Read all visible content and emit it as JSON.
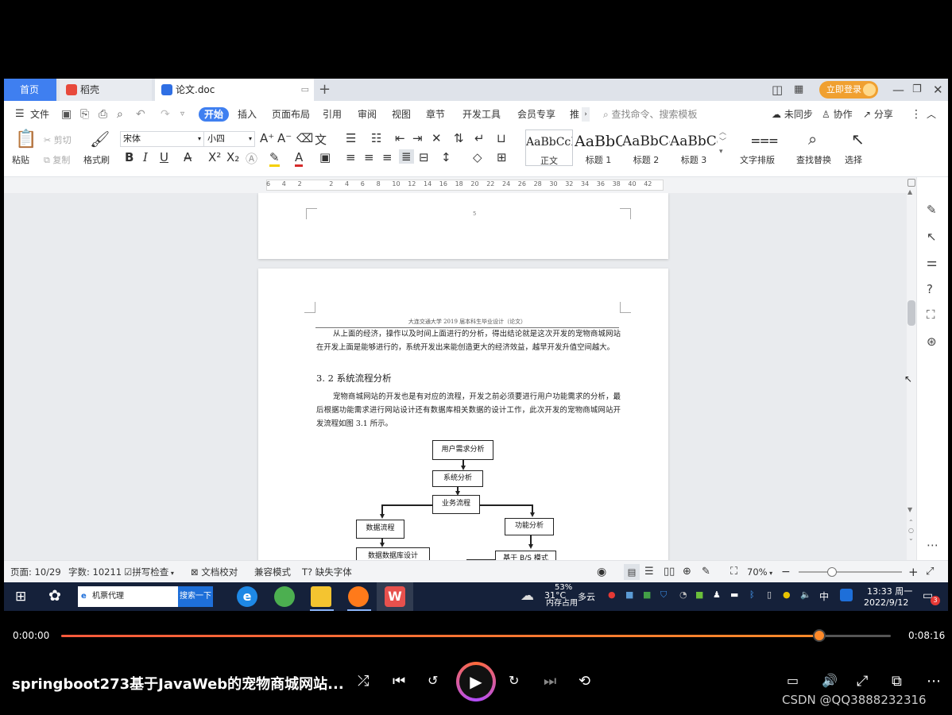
{
  "tabs": {
    "home": "首页",
    "daoke": "稻壳",
    "doc": "论文.doc",
    "login": "立即登录"
  },
  "menu": {
    "file": "文件",
    "items": [
      "开始",
      "插入",
      "页面布局",
      "引用",
      "审阅",
      "视图",
      "章节",
      "开发工具",
      "会员专享",
      "推"
    ],
    "search_placeholder": "查找命令、搜索模板",
    "unsynced": "未同步",
    "collab": "协作",
    "share": "分享"
  },
  "ribbon": {
    "paste": "粘贴",
    "cut": "剪切",
    "copy": "复制",
    "format_painter": "格式刷",
    "font_name": "宋体",
    "font_size": "小四",
    "styles": [
      {
        "sample": "AaBbCcI",
        "name": "正文"
      },
      {
        "sample": "AaBbC",
        "name": "标题 1"
      },
      {
        "sample": "AaBbCc",
        "name": "标题 2"
      },
      {
        "sample": "AaBbCc",
        "name": "标题 3"
      }
    ],
    "text_layout": "文字排版",
    "find_replace": "查找替换",
    "select": "选择"
  },
  "ruler_ticks": [
    "6",
    "4",
    "2",
    "",
    "2",
    "4",
    "6",
    "8",
    "10",
    "12",
    "14",
    "16",
    "18",
    "20",
    "22",
    "24",
    "26",
    "28",
    "30",
    "32",
    "34",
    "36",
    "38",
    "40",
    "42"
  ],
  "document": {
    "page_number_prev": "5",
    "header": "大连交通大学 2019 届本科生毕业设计（论文）",
    "para1": "从上面的经济，操作以及时间上面进行的分析，得出结论就是这次开发的宠物商城网站在开发上面是能够进行的，系统开发出来能创造更大的经济效益，越早开发升值空间越大。",
    "section_title": "3. 2 系统流程分析",
    "para2": "宠物商城网站的开发也是有对应的流程，开发之前必须要进行用户功能需求的分析，最后根据功能需求进行网站设计还有数据库相关数据的设计工作，此次开发的宠物商城网站开发流程如图 3.1 所示。",
    "flow": {
      "user_req": "用户需求分析",
      "sys_analysis": "系统分析",
      "business": "业务流程",
      "data_flow": "数据流程",
      "func_analysis": "功能分析",
      "db_design": "数据数据库设计",
      "bs_mode": "基于 B/S 模式"
    }
  },
  "statusbar": {
    "page": "页面: 10/29",
    "words": "字数: 10211",
    "spell": "拼写检查",
    "doc_check": "文档校对",
    "compat": "兼容模式",
    "missing_font": "缺失字体",
    "zoom": "70%"
  },
  "taskbar": {
    "search_text": "机票代理",
    "search_btn": "搜索一下",
    "temp": "31°C",
    "weather": "多云",
    "mem_pct": "53%",
    "mem_label": "内存占用",
    "ime": "中",
    "time": "13:33 周一",
    "date": "2022/9/12",
    "notify_count": "3"
  },
  "player": {
    "current_time": "0:00:00",
    "total_time": "0:08:16",
    "progress": 0.914,
    "title": "springboot273基于JavaWeb的宠物商城网站...",
    "watermark": "CSDN @QQ3888232316"
  }
}
